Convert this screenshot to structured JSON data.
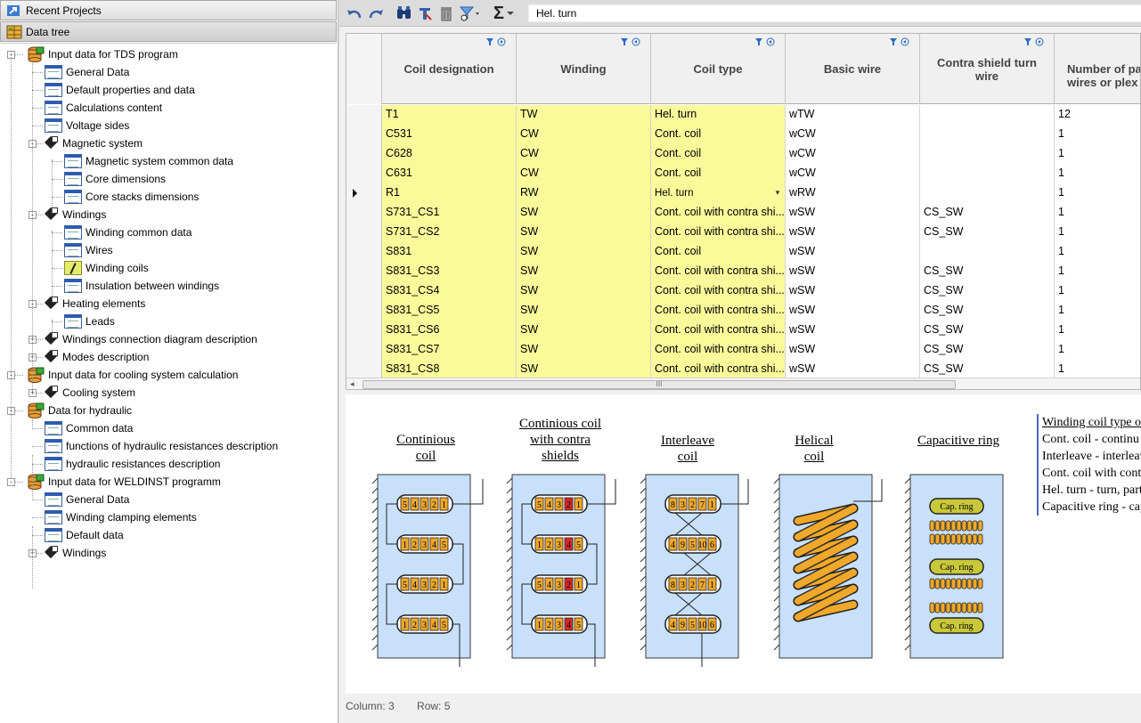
{
  "left_panel": {
    "recent_projects": "Recent Projects",
    "data_tree": "Data tree",
    "tree": [
      {
        "label": "Input data for TDS program",
        "icon": "db-icon",
        "level": 0,
        "toggle": "-"
      },
      {
        "label": "General Data",
        "icon": "table-icon",
        "level": 1
      },
      {
        "label": "Default properties and data",
        "icon": "table-icon",
        "level": 1
      },
      {
        "label": "Calculations content",
        "icon": "table-icon",
        "level": 1
      },
      {
        "label": "Voltage sides",
        "icon": "table-icon",
        "level": 1
      },
      {
        "label": "Magnetic system",
        "icon": "magnet-icon",
        "level": 1,
        "toggle": "-"
      },
      {
        "label": "Magnetic system common data",
        "icon": "table-icon",
        "level": 2
      },
      {
        "label": "Core dimensions",
        "icon": "table-icon",
        "level": 2
      },
      {
        "label": "Core stacks dimensions",
        "icon": "table-icon",
        "level": 2
      },
      {
        "label": "Windings",
        "icon": "magnet-icon",
        "level": 1,
        "toggle": "-"
      },
      {
        "label": "Winding common data",
        "icon": "table-icon",
        "level": 2
      },
      {
        "label": "Wires",
        "icon": "table-icon",
        "level": 2
      },
      {
        "label": "Winding coils",
        "icon": "coil-icon",
        "level": 2
      },
      {
        "label": "Insulation between windings",
        "icon": "table-icon",
        "level": 2
      },
      {
        "label": "Heating elements",
        "icon": "magnet-icon",
        "level": 1,
        "toggle": "-"
      },
      {
        "label": "Leads",
        "icon": "table-icon",
        "level": 2
      },
      {
        "label": "Windings connection diagram description",
        "icon": "magnet-icon",
        "level": 1,
        "toggle": "+"
      },
      {
        "label": "Modes description",
        "icon": "magnet-icon",
        "level": 1,
        "toggle": "+"
      },
      {
        "label": "Input data for cooling system calculation",
        "icon": "db-icon",
        "level": 0,
        "toggle": "-"
      },
      {
        "label": "Cooling system",
        "icon": "magnet-icon",
        "level": 1,
        "toggle": "+"
      },
      {
        "label": "Data for hydraulic",
        "icon": "db-icon",
        "level": 0,
        "toggle": "-"
      },
      {
        "label": "Common data",
        "icon": "table-icon",
        "level": 1
      },
      {
        "label": "functions of hydraulic resistances description",
        "icon": "table-icon",
        "level": 1
      },
      {
        "label": "hydraulic resistances description",
        "icon": "table-icon",
        "level": 1
      },
      {
        "label": "Input data for WELDINST programm",
        "icon": "db-icon",
        "level": 0,
        "toggle": "-"
      },
      {
        "label": "General Data",
        "icon": "table-icon",
        "level": 1
      },
      {
        "label": "Winding clamping elements",
        "icon": "table-icon",
        "level": 1
      },
      {
        "label": "Default data",
        "icon": "table-icon",
        "level": 1
      },
      {
        "label": "Windings",
        "icon": "magnet-icon",
        "level": 1,
        "toggle": "+"
      }
    ]
  },
  "toolbar": {
    "filter_text": "Hel. turn",
    "sum_symbol": "Σ"
  },
  "grid": {
    "columns": [
      "Coil designation",
      "Winding",
      "Coil type",
      "Basic wire",
      "Contra shield turn wire",
      "Number of pa wires or plex radial"
    ],
    "rows": [
      [
        "T1",
        "TW",
        "Hel. turn",
        "wTW",
        "",
        "12"
      ],
      [
        "C531",
        "CW",
        "Cont. coil",
        "wCW",
        "",
        "1"
      ],
      [
        "C628",
        "CW",
        "Cont. coil",
        "wCW",
        "",
        "1"
      ],
      [
        "C631",
        "CW",
        "Cont. coil",
        "wCW",
        "",
        "1"
      ],
      [
        "R1",
        "RW",
        "Hel. turn",
        "wRW",
        "",
        "1"
      ],
      [
        "S731_CS1",
        "SW",
        "Cont. coil with contra shi...",
        "wSW",
        "CS_SW",
        "1"
      ],
      [
        "S731_CS2",
        "SW",
        "Cont. coil with contra shi...",
        "wSW",
        "CS_SW",
        "1"
      ],
      [
        "S831",
        "SW",
        "Cont. coil",
        "wSW",
        "",
        "1"
      ],
      [
        "S831_CS3",
        "SW",
        "Cont. coil with contra shi...",
        "wSW",
        "CS_SW",
        "1"
      ],
      [
        "S831_CS4",
        "SW",
        "Cont. coil with contra shi...",
        "wSW",
        "CS_SW",
        "1"
      ],
      [
        "S831_CS5",
        "SW",
        "Cont. coil with contra shi...",
        "wSW",
        "CS_SW",
        "1"
      ],
      [
        "S831_CS6",
        "SW",
        "Cont. coil with contra shi...",
        "wSW",
        "CS_SW",
        "1"
      ],
      [
        "S831_CS7",
        "SW",
        "Cont. coil with contra shi...",
        "wSW",
        "CS_SW",
        "1"
      ],
      [
        "S831_CS8",
        "SW",
        "Cont. coil with contra shi...",
        "wSW",
        "CS_SW",
        "1"
      ]
    ],
    "current_row_index": 4,
    "scroll_thumb_text": "III"
  },
  "diagram": {
    "titles": {
      "continious": "Continious coil",
      "contra": "Continious coil with contra shields",
      "interleave": "Interleave coil",
      "helical": "Helical coil",
      "capacitive": "Capacitive ring"
    },
    "cap_ring_label": "Cap. ring",
    "disc_a": [
      "5",
      "4",
      "3",
      "2",
      "1"
    ],
    "disc_b": [
      "1",
      "2",
      "3",
      "4",
      "5"
    ],
    "disc_i1": [
      "8",
      "3",
      "2",
      "7",
      "1"
    ],
    "disc_i2": [
      "4",
      "9",
      "5",
      "10",
      "6"
    ],
    "legend_title": "Winding coil type or",
    "legend_lines": [
      "Cont. coil - continu",
      "Interleave - interleav",
      "Cont. coil with cont",
      "Hel. turn - turn, part",
      "Capacitive ring - cap"
    ]
  },
  "status": {
    "column": "Column: 3",
    "row": "Row: 5"
  },
  "colors": {
    "grid_yellow": "#fafa9a",
    "coil_orange": "#f0a82a",
    "shield_red": "#d42828",
    "diagram_blue": "#c8e0fa"
  }
}
